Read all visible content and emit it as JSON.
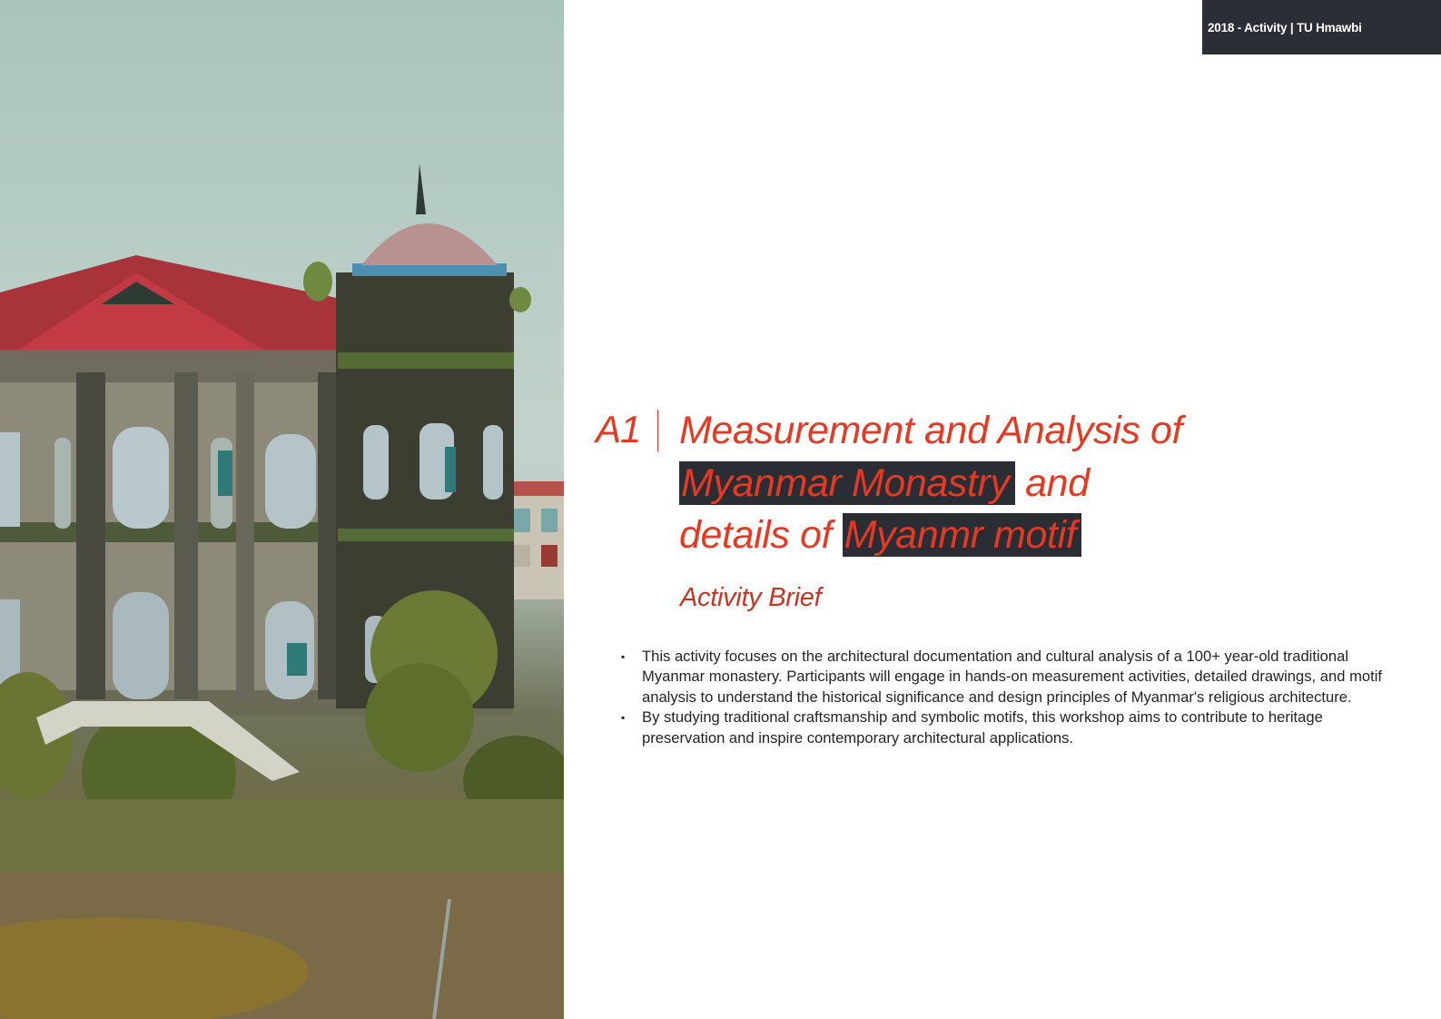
{
  "header": {
    "badge_text": "2018 - Activity | TU Hmawbi"
  },
  "activity": {
    "code": "A1",
    "title_part1": "Measurement and Analysis of",
    "title_highlight1": "Myanmar Monastry",
    "title_part2": "and",
    "title_part3": "details of",
    "title_highlight2": "Myanmr motif",
    "subtitle": "Activity Brief"
  },
  "brief": {
    "bullets": [
      "This activity focuses on the architectural documentation and cultural analysis of a 100+ year-old traditional Myanmar monastery. Participants will engage in hands-on measurement activities, detailed drawings, and motif analysis to understand the historical significance and design principles of Myanmar's religious architecture.",
      "By studying traditional craftsmanship and symbolic motifs, this workshop aims to contribute to heritage preservation and inspire contemporary architectural applications."
    ],
    "bullet_symbol": "▪"
  },
  "colors": {
    "accent": "#e43a24",
    "badge_bg": "#2b2e34",
    "highlight_bg": "#2a2d33",
    "body_text": "#222428"
  },
  "photo": {
    "subject": "old colonial-style monastery building with red roof and domed tower"
  }
}
